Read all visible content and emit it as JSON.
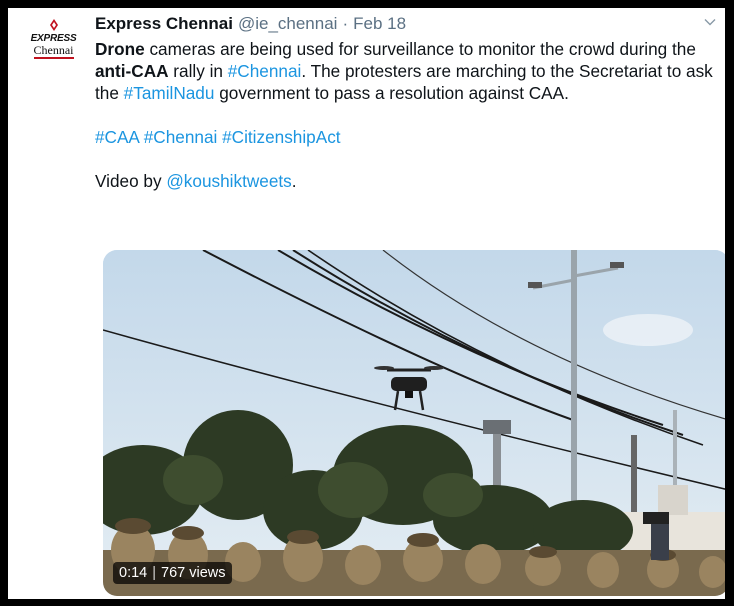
{
  "tweet": {
    "avatar": {
      "logo_line1": "EXPRESS",
      "logo_line2": "Chennai"
    },
    "author": {
      "name": "Express Chennai",
      "handle": "@ie_chennai",
      "separator": "·",
      "date": "Feb 18"
    },
    "body": {
      "s1_bold": "Drone",
      "s1_text": " cameras are being used for surveillance to monitor the crowd during the ",
      "s1_bold2": "anti-CAA",
      "s1_text2": " rally in ",
      "s1_link": "#Chennai",
      "s1_text3": ". The protesters are marching to the Secretariat to ask the ",
      "s1_link2": "#TamilNadu",
      "s1_text4": " government to pass a resolution against CAA.",
      "tags": [
        "#CAA",
        "#Chennai",
        "#CitizenshipAct"
      ],
      "credit_prefix": "Video by ",
      "credit_link": "@koushiktweets",
      "credit_suffix": "."
    },
    "video": {
      "time": "0:14",
      "views": "767 views"
    }
  },
  "colors": {
    "link": "#1b95e0",
    "brand_red": "#c1121f",
    "text": "#0f1419",
    "muted": "#5b7083"
  }
}
